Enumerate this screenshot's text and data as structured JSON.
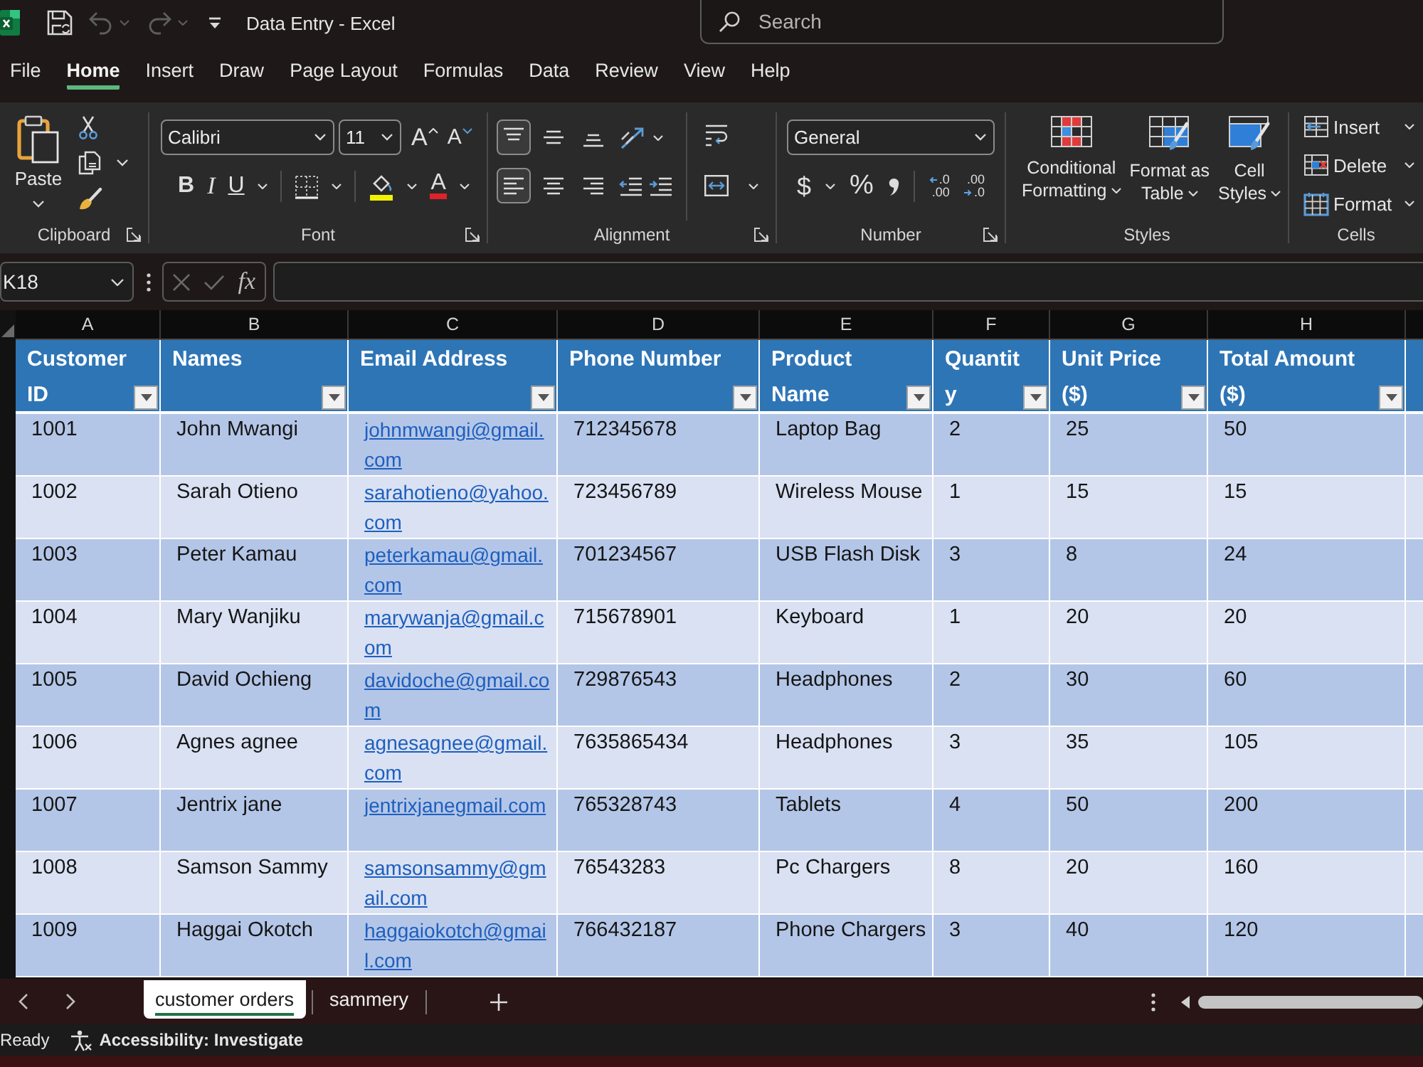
{
  "title_bar": {
    "title": "Data Entry - Excel",
    "search": {
      "placeholder": "Search"
    }
  },
  "quick_access": [
    {
      "kind": "save",
      "disabled": false
    },
    {
      "kind": "undo",
      "disabled": true
    },
    {
      "kind": "redo",
      "disabled": true
    }
  ],
  "menu_tabs": [
    {
      "label": "File",
      "selected": false
    },
    {
      "label": "Home",
      "selected": true
    },
    {
      "label": "Insert",
      "selected": false
    },
    {
      "label": "Draw",
      "selected": false
    },
    {
      "label": "Page Layout",
      "selected": false
    },
    {
      "label": "Formulas",
      "selected": false
    },
    {
      "label": "Data",
      "selected": false
    },
    {
      "label": "Review",
      "selected": false
    },
    {
      "label": "View",
      "selected": false
    },
    {
      "label": "Help",
      "selected": false
    }
  ],
  "ribbon": {
    "clipboard": {
      "paste": "Paste",
      "label": "Clipboard"
    },
    "font": {
      "name": "Calibri",
      "size": "11",
      "grow": "A",
      "shrink": "A",
      "bold": "B",
      "italic": "I",
      "underline": "U",
      "color_letter": "A",
      "label": "Font"
    },
    "alignment": {
      "vertical": [
        {
          "kind": "top",
          "selected": true
        },
        {
          "kind": "middle",
          "selected": false
        },
        {
          "kind": "bottom",
          "selected": false
        }
      ],
      "horizontal": [
        {
          "kind": "left",
          "selected": true
        },
        {
          "kind": "center",
          "selected": false
        },
        {
          "kind": "right",
          "selected": false
        }
      ],
      "label": "Alignment"
    },
    "number": {
      "format": "General",
      "currency": "$",
      "percent": "%",
      "decimals": [
        {
          "kind": "increase",
          "top": ".0",
          "bottom": ".00"
        },
        {
          "kind": "decrease",
          "top": ".00",
          "bottom": ".0"
        }
      ],
      "label": "Number"
    },
    "styles": {
      "buttons": [
        {
          "kind": "conditional",
          "lines": [
            "Conditional",
            "Formatting"
          ]
        },
        {
          "kind": "table",
          "lines": [
            "Format as",
            "Table"
          ]
        },
        {
          "kind": "cell",
          "lines": [
            "Cell",
            "Styles"
          ]
        }
      ],
      "label": "Styles"
    },
    "cells": {
      "buttons": [
        {
          "kind": "insert",
          "label": "Insert"
        },
        {
          "kind": "delete",
          "label": "Delete"
        },
        {
          "kind": "format",
          "label": "Format"
        }
      ],
      "label": "Cells"
    }
  },
  "formula_bar": {
    "name_box": "K18",
    "buttons": [
      {
        "kind": "cancel",
        "disabled": true
      },
      {
        "kind": "enter",
        "disabled": true
      }
    ],
    "function_label": "fx"
  },
  "sheet": {
    "columns": [
      {
        "letter": "A",
        "header": "Customer ID",
        "kind": "text"
      },
      {
        "letter": "B",
        "header": "Names",
        "kind": "text"
      },
      {
        "letter": "C",
        "header": "Email Address",
        "kind": "link"
      },
      {
        "letter": "D",
        "header": "Phone Number",
        "kind": "text"
      },
      {
        "letter": "E",
        "header": "Product Name",
        "kind": "text"
      },
      {
        "letter": "F",
        "header": "Quantity",
        "kind": "text"
      },
      {
        "letter": "G",
        "header": "Unit Price ($)",
        "kind": "text"
      },
      {
        "letter": "H",
        "header": "Total Amount ($)",
        "kind": "text"
      }
    ],
    "rows": [
      [
        "1001",
        "John Mwangi",
        "johnmwangi@gmail.com",
        "712345678",
        "Laptop Bag",
        "2",
        "25",
        "50"
      ],
      [
        "1002",
        "Sarah Otieno",
        "sarahotieno@yahoo.com",
        "723456789",
        "Wireless Mouse",
        "1",
        "15",
        "15"
      ],
      [
        "1003",
        "Peter Kamau",
        "peterkamau@gmail.com",
        "701234567",
        "USB Flash Disk",
        "3",
        "8",
        "24"
      ],
      [
        "1004",
        "Mary Wanjiku",
        "marywanja@gmail.com",
        "715678901",
        "Keyboard",
        "1",
        "20",
        "20"
      ],
      [
        "1005",
        "David Ochieng",
        "davidoche@gmail.com",
        "729876543",
        "Headphones",
        "2",
        "30",
        "60"
      ],
      [
        "1006",
        "Agnes agnee",
        "agnesagnee@gmail.com",
        "7635865434",
        "Headphones",
        "3",
        "35",
        "105"
      ],
      [
        "1007",
        "Jentrix jane",
        "jentrixjanegmail.com",
        "765328743",
        "Tablets",
        "4",
        "50",
        "200"
      ],
      [
        "1008",
        "Samson Sammy",
        "samsonsammy@gmail.com",
        "76543283",
        "Pc Chargers",
        "8",
        "20",
        "160"
      ],
      [
        "1009",
        "Haggai Okotch",
        "haggaiokotch@gmail.com",
        "766432187",
        "Phone Chargers",
        "3",
        "40",
        "120"
      ]
    ]
  },
  "sheet_tabs": [
    {
      "label": "customer orders",
      "selected": true
    },
    {
      "label": "sammery",
      "selected": false
    }
  ],
  "status_bar": {
    "mode": "Ready",
    "accessibility": "Accessibility: Investigate"
  }
}
